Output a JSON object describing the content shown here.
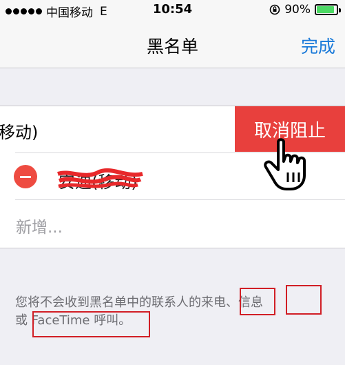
{
  "status_bar": {
    "carrier": "中国移动",
    "network": "E",
    "time": "10:54",
    "battery": "90%",
    "battery_level": 0.9,
    "battery_color": "#4cd964",
    "signal_dots": 5
  },
  "nav": {
    "title": "黑名单",
    "done_label": "完成",
    "accent_color": "#1a7ad9"
  },
  "list": {
    "row1_text": "移动)",
    "unblock_label": "取消阻止",
    "unblock_color": "#e8403d",
    "row2_text": "安迪(移动)",
    "add_new_label": "新增..."
  },
  "footer": {
    "line1_prefix": "您将不会收到黑名单中的联系人的",
    "calls": "来电",
    "separator": "、",
    "messages": "信息",
    "or": "或 ",
    "facetime": "FaceTime 呼叫",
    "period": "。",
    "highlight_color": "#d11e25"
  },
  "icons": {
    "hand_cursor": "hand-pointer-icon",
    "remove": "minus-circle-icon",
    "rotation_lock": "rotation-lock-icon"
  }
}
